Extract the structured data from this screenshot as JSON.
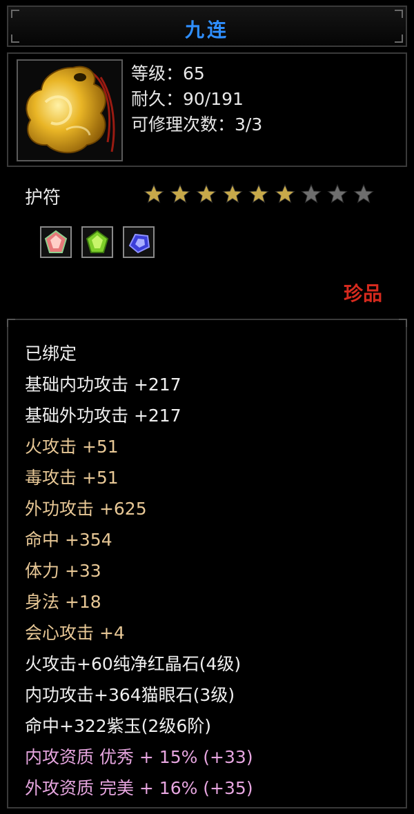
{
  "item": {
    "name": "九连",
    "name_color": "#2f8fff",
    "icon": "amulet-icon",
    "stats": [
      "等级：65",
      "耐久：90/191",
      "可修理次数：3/3"
    ],
    "type": "护符",
    "stars": {
      "filled": 6,
      "total": 9,
      "filled_color": "#c7a94a",
      "empty_color": "#6e6e6e"
    },
    "gems": [
      "red-gem-icon",
      "green-gem-icon",
      "blue-gem-icon"
    ],
    "quality": "珍品",
    "quality_color": "#d62a1e"
  },
  "attributes": [
    {
      "text": "已绑定",
      "color": "#f0f0f0"
    },
    {
      "text": "基础内功攻击 +217",
      "color": "#f0f0f0"
    },
    {
      "text": "基础外功攻击 +217",
      "color": "#f0f0f0"
    },
    {
      "text": "火攻击 +51",
      "color": "#e8c896"
    },
    {
      "text": "毒攻击 +51",
      "color": "#e8c896"
    },
    {
      "text": "外功攻击 +625",
      "color": "#e8c896"
    },
    {
      "text": "命中 +354",
      "color": "#e8c896"
    },
    {
      "text": "体力 +33",
      "color": "#e8c896"
    },
    {
      "text": "身法 +18",
      "color": "#e8c896"
    },
    {
      "text": "会心攻击 +4",
      "color": "#e8c896"
    },
    {
      "text": "火攻击+60纯净红晶石(4级)",
      "color": "#f0f0f0"
    },
    {
      "text": "内功攻击+364猫眼石(3级)",
      "color": "#f0f0f0"
    },
    {
      "text": "命中+322紫玉(2级6阶)",
      "color": "#f0f0f0"
    },
    {
      "text": "内攻资质 优秀 + 15% (+33)",
      "color": "#e7a6e0"
    },
    {
      "text": "外攻资质 完美 + 16% (+35)",
      "color": "#e7a6e0"
    }
  ]
}
